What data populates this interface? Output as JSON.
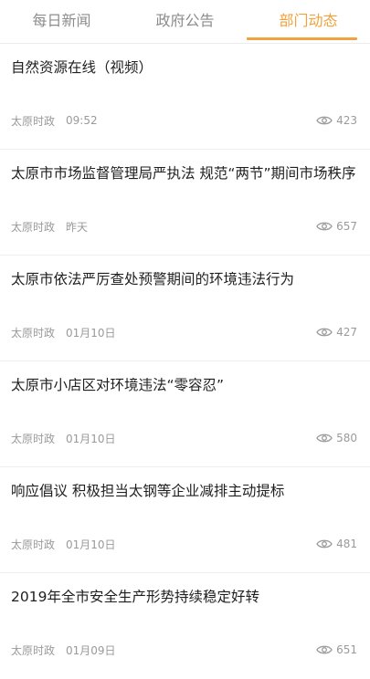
{
  "tabs": [
    {
      "label": "每日新闻"
    },
    {
      "label": "政府公告"
    },
    {
      "label": "部门动态"
    }
  ],
  "active_tab": "部门动态",
  "accent_color": "#f0a23c",
  "eye_icon": "eye-icon",
  "news": [
    {
      "title": "自然资源在线（视频）",
      "source": "太原时政",
      "time": "09:52",
      "views": "423"
    },
    {
      "title": "太原市市场监督管理局严执法 规范“两节”期间市场秩序",
      "source": "太原时政",
      "time": "昨天",
      "views": "657"
    },
    {
      "title": "太原市依法严厉查处预警期间的环境违法行为",
      "source": "太原时政",
      "time": "01月10日",
      "views": "427"
    },
    {
      "title": "太原市小店区对环境违法“零容忍”",
      "source": "太原时政",
      "time": "01月10日",
      "views": "580"
    },
    {
      "title": "响应倡议 积极担当太钢等企业减排主动提标",
      "source": "太原时政",
      "time": "01月10日",
      "views": "481"
    },
    {
      "title": "2019年全市安全生产形势持续稳定好转",
      "source": "太原时政",
      "time": "01月09日",
      "views": "651"
    }
  ]
}
